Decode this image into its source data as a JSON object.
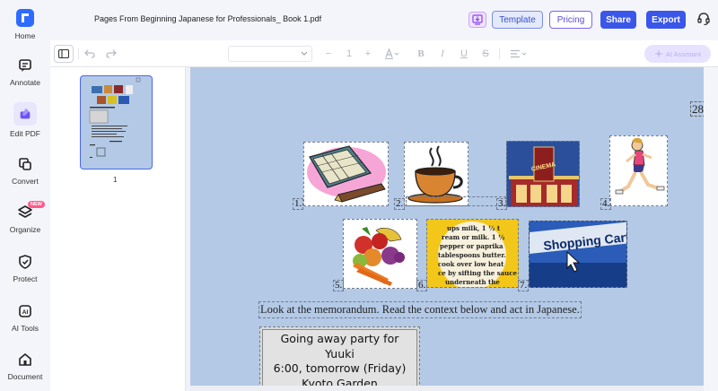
{
  "sidebar": {
    "items": [
      {
        "label": "Home",
        "icon": "app-logo-icon"
      },
      {
        "label": "Annotate",
        "icon": "annotate-icon"
      },
      {
        "label": "Edit PDF",
        "icon": "edit-pdf-icon",
        "active": true
      },
      {
        "label": "Convert",
        "icon": "convert-icon"
      },
      {
        "label": "Organize",
        "icon": "layers-icon",
        "badge": "NEW"
      },
      {
        "label": "Protect",
        "icon": "shield-icon"
      },
      {
        "label": "AI Tools",
        "icon": "ai-tools-icon"
      },
      {
        "label": "Document",
        "icon": "house-icon"
      }
    ]
  },
  "header": {
    "title": "Pages From Beginning Japanese for Professionals_ Book 1.pdf",
    "template_label": "Template",
    "pricing_label": "Pricing",
    "share_label": "Share",
    "export_label": "Export"
  },
  "toolbar": {
    "font_size": "1",
    "ai_assistant_label": "AI Assistant"
  },
  "thumbnails": {
    "pages": [
      {
        "number": "1"
      }
    ]
  },
  "page": {
    "page_number": "28",
    "picture_labels": [
      "1.",
      "2.",
      "3.",
      "4.",
      "5.",
      "6.",
      "7."
    ],
    "picture_text": {
      "cinema_sign": "CINEMA",
      "newspaper_text": [
        "ups milk, 1 ½ t",
        "ream or milk. 1 ½",
        "pepper or paprika",
        "tablespoons butter.",
        "cook over low heat",
        "ce by sifting the sauce",
        "underneath the"
      ],
      "shopping_text": "Shopping Cart"
    },
    "instruction": "Look at the memorandum.  Read the context below and act in Japanese.",
    "memo_lines": [
      "Going away party for",
      "Yuuki",
      "6:00, tomorrow (Friday)",
      "Kyoto Garden"
    ]
  },
  "colors": {
    "accent": "#3a57ea",
    "page_background": "#b3c9e6",
    "active_nav": "#e7e6fb"
  }
}
